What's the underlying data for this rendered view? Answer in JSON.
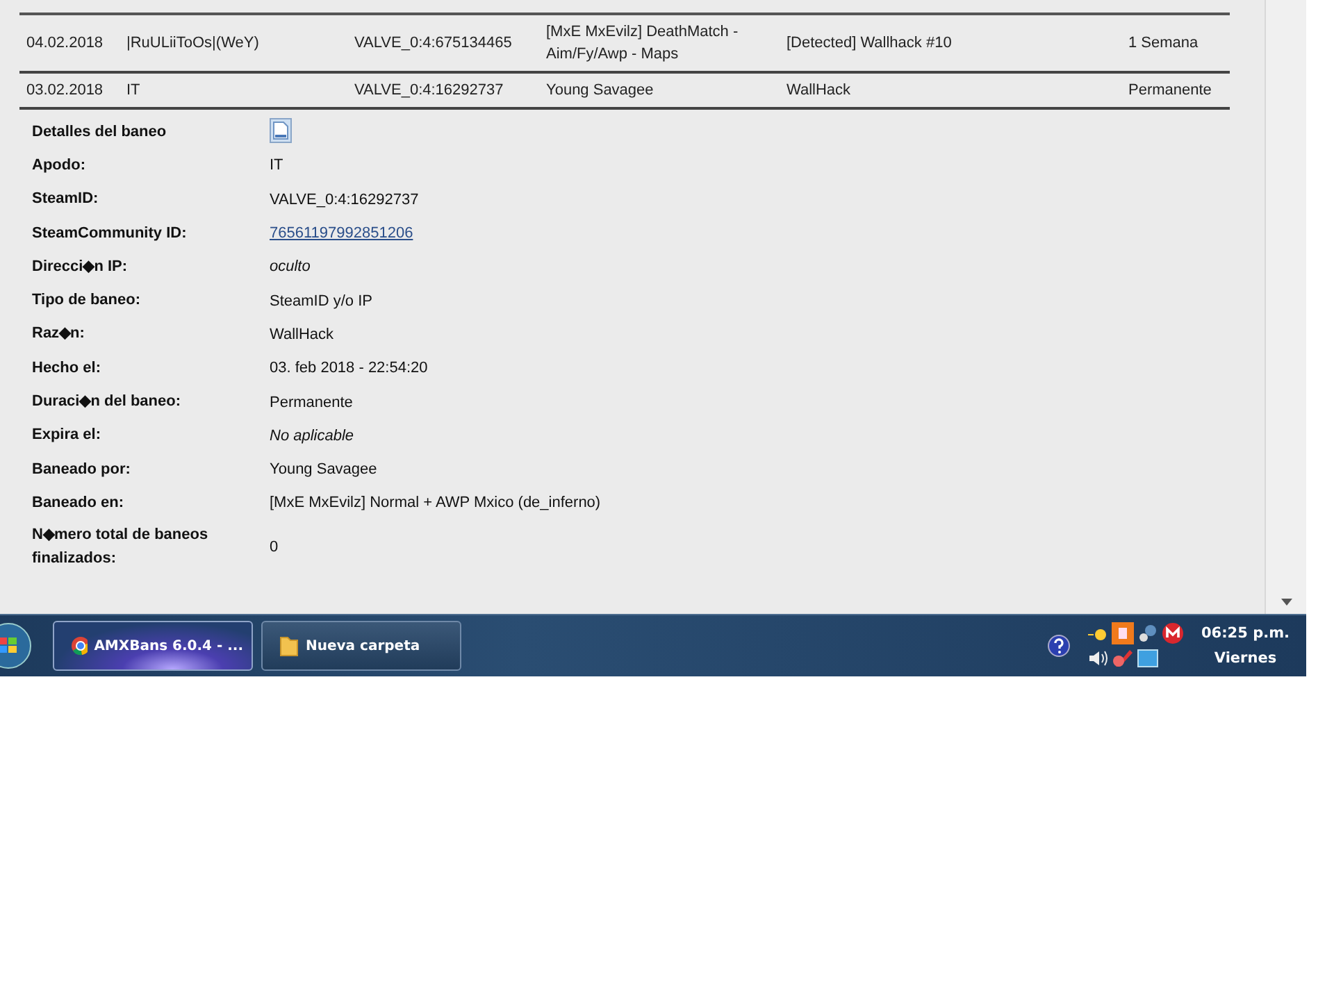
{
  "ban_table": {
    "rows": [
      {
        "date": "04.02.2018",
        "nick": "|RuULiiToOs|(WeY)",
        "steamid": "VALVE_0:4:675134465",
        "server": "[MxE MxEvilz] DeathMatch - Aim/Fy/Awp - Maps",
        "reason": "[Detected] Wallhack #10",
        "length": "1 Semana"
      },
      {
        "date": "03.02.2018",
        "nick": "IT",
        "steamid": "VALVE_0:4:16292737",
        "server": "Young Savagee",
        "reason": "WallHack",
        "length": "Permanente"
      }
    ]
  },
  "ban_details": {
    "title": "Detalles del baneo",
    "fields": [
      {
        "label": "Apodo:",
        "value": "IT",
        "kind": "text"
      },
      {
        "label": "SteamID:",
        "value": "VALVE_0:4:16292737",
        "kind": "text"
      },
      {
        "label": "SteamCommunity ID:",
        "value": "76561197992851206",
        "kind": "link"
      },
      {
        "label": "Direcci◆n IP:",
        "value": "oculto",
        "kind": "italic"
      },
      {
        "label": "Tipo de baneo:",
        "value": "SteamID y/o IP",
        "kind": "text"
      },
      {
        "label": "Raz◆n:",
        "value": "WallHack",
        "kind": "text"
      },
      {
        "label": "Hecho el:",
        "value": "03. feb 2018 - 22:54:20",
        "kind": "text"
      },
      {
        "label": "Duraci◆n del baneo:",
        "value": "Permanente",
        "kind": "text"
      },
      {
        "label": "Expira el:",
        "value": "No aplicable",
        "kind": "italic"
      },
      {
        "label": "Baneado por:",
        "value": "Young Savagee",
        "kind": "text"
      },
      {
        "label": "Baneado en:",
        "value": "[MxE MxEvilz] Normal + AWP Mxico (de_inferno)",
        "kind": "text"
      },
      {
        "label": "N◆mero total de baneos finalizados:",
        "value": "0",
        "kind": "text"
      }
    ]
  },
  "taskbar": {
    "buttons": [
      {
        "label": "AMXBans 6.0.4 - ...",
        "kind": "browser",
        "selected": true
      },
      {
        "label": "Nueva carpeta",
        "kind": "folder",
        "selected": false
      }
    ],
    "clock": {
      "time": "06:25 p.m.",
      "day": "Viernes"
    }
  }
}
